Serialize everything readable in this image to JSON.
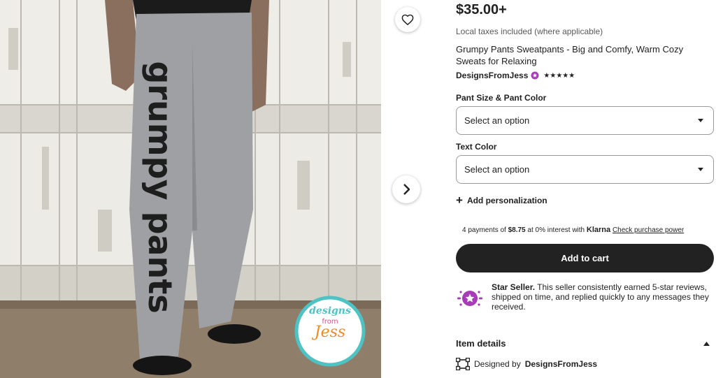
{
  "photo": {
    "pants_text": "grumpy pants",
    "logo": {
      "line1": "designs",
      "line2": "from",
      "line3": "Jess"
    }
  },
  "product": {
    "price": "$35.00+",
    "taxes_note": "Local taxes included (where applicable)",
    "title": "Grumpy Pants Sweatpants - Big and Comfy, Warm Cozy Sweats for Relaxing",
    "shop_name": "DesignsFromJess",
    "stars": "★★★★★"
  },
  "options": {
    "pant_size_label": "Pant Size & Pant Color",
    "pant_size_placeholder": "Select an option",
    "text_color_label": "Text Color",
    "text_color_placeholder": "Select an option"
  },
  "personalization": {
    "label": "Add personalization"
  },
  "klarna": {
    "prefix": "4 payments of",
    "amount": "$8.75",
    "middle": "at 0% interest with",
    "brand": "Klarna",
    "link": "Check purchase power"
  },
  "cart": {
    "label": "Add to cart"
  },
  "star_seller": {
    "title": "Star Seller.",
    "text": "This seller consistently earned 5-star reviews, shipped on time, and replied quickly to any messages they received."
  },
  "item_details": {
    "label": "Item details",
    "designed_by_prefix": "Designed by",
    "designer": "DesignsFromJess"
  },
  "colors": {
    "accent": "#222222",
    "star_seller_purple": "#a83bb7",
    "logo_teal": "#4fc3c4",
    "logo_orange": "#f08a24"
  },
  "icons": {
    "favorite": "heart-icon",
    "next": "chevron-right-icon",
    "select_caret": "caret-down-icon",
    "personalize": "plus-icon",
    "star_seller": "star-seller-badge-icon",
    "collapse": "chevron-up-icon",
    "designed": "designed-by-icon"
  }
}
